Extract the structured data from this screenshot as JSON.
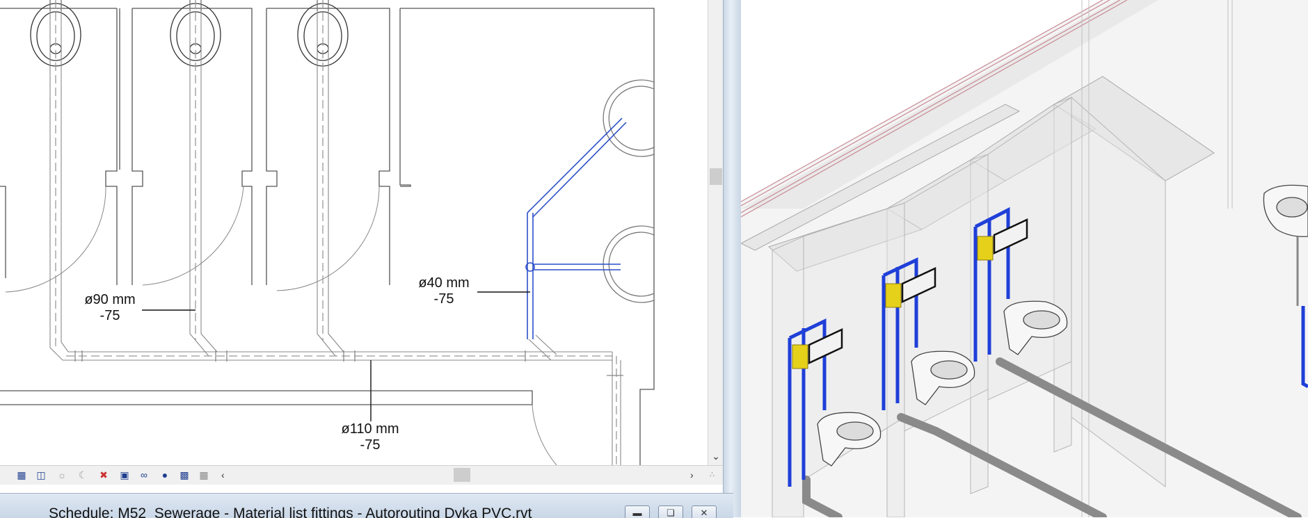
{
  "plan_view": {
    "dimensions": [
      {
        "size": "ø90 mm",
        "offset": "-75"
      },
      {
        "size": "ø40 mm",
        "offset": "-75"
      },
      {
        "size": "ø110 mm",
        "offset": "-75"
      }
    ]
  },
  "view_control_bar": {
    "icons": [
      "scale-icon",
      "detail-level-icon",
      "visual-style-icon",
      "sun-path-icon",
      "shadows-icon",
      "crop-view-icon",
      "show-crop-icon",
      "temporary-hide-icon",
      "reveal-hidden-icon",
      "temporary-view-properties-icon",
      "analytical-model-icon"
    ]
  },
  "schedule_window": {
    "title": "Schedule: M52_Sewerage - Material list fittings - Autorouting Dyka PVC.rvt"
  },
  "colors": {
    "pipe_blue": "#2b4fc8",
    "frame_blue": "#1f3fd8",
    "flush_yellow": "#e6d11a",
    "drawing_line": "#444444"
  }
}
